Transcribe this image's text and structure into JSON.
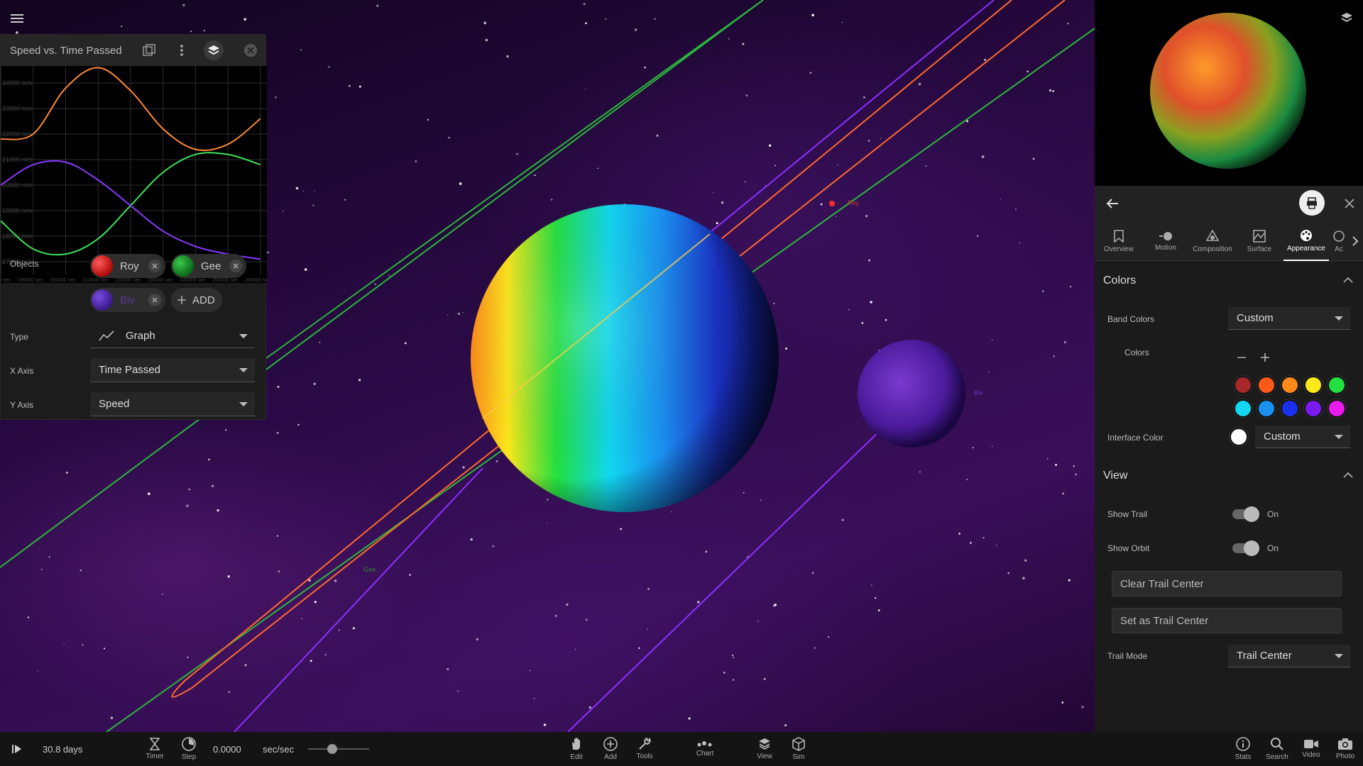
{
  "viewport": {
    "labels": {
      "roy": "Roy",
      "gee": "Gee",
      "biv": "Biv"
    }
  },
  "chart_window": {
    "title": "Speed vs. Time Passed",
    "objects_label": "Objects",
    "objects": [
      {
        "name": "Roy",
        "color": "#d21a1a"
      },
      {
        "name": "Gee",
        "color": "#1a8a2a"
      },
      {
        "name": "Biv",
        "color": "#5a2ab8"
      }
    ],
    "add_label": "ADD",
    "type_label": "Type",
    "type_value": "Graph",
    "x_axis_label": "X Axis",
    "x_axis_value": "Time Passed",
    "y_axis_label": "Y Axis",
    "y_axis_value": "Speed"
  },
  "chart_data": {
    "type": "line",
    "ylabel_ticks": [
      "24000 m/s",
      "23000 m/s",
      "22000 m/s",
      "21000 m/s",
      "20000 m/s",
      "19000 m/s",
      "18000 m/s",
      "17000 m/s"
    ],
    "x_ticks": [
      "180000 sec",
      "190000 sec",
      "200000 sec",
      "210000 sec",
      "220000 sec",
      "230000 sec",
      "240000 sec",
      "250000 sec",
      "260000 sec"
    ],
    "ylim": [
      16500,
      24500
    ],
    "xlim": [
      180000,
      262000
    ],
    "grid": true,
    "series": [
      {
        "name": "Roy",
        "color": "#ff8a3a",
        "x": [
          180000,
          190000,
          200000,
          210000,
          220000,
          230000,
          240000,
          250000,
          260000
        ],
        "y": [
          21800,
          22000,
          23800,
          24600,
          23700,
          22200,
          21400,
          21600,
          22600
        ]
      },
      {
        "name": "Gee",
        "color": "#3ae35a",
        "x": [
          180000,
          190000,
          200000,
          210000,
          220000,
          230000,
          240000,
          250000,
          260000
        ],
        "y": [
          18600,
          17500,
          17300,
          17900,
          19200,
          20500,
          21200,
          21200,
          20800
        ]
      },
      {
        "name": "Biv",
        "color": "#8a3aff",
        "x": [
          180000,
          190000,
          200000,
          210000,
          220000,
          230000,
          240000,
          250000,
          260000
        ],
        "y": [
          20000,
          20800,
          20900,
          20200,
          19200,
          18200,
          17600,
          17300,
          17100
        ]
      }
    ]
  },
  "panel": {
    "tabs": [
      "Overview",
      "Motion",
      "Composition",
      "Surface",
      "Appearance",
      "Ac"
    ],
    "active_tab": "Appearance",
    "colors_section": "Colors",
    "band_colors_label": "Band Colors",
    "band_colors_value": "Custom",
    "colors_label": "Colors",
    "swatches": [
      "#a8282a",
      "#ff5a1a",
      "#ff8a1a",
      "#ffe81a",
      "#22e040",
      "#11d8f0",
      "#1a90f0",
      "#1a30f0",
      "#7a1af0",
      "#e81af0"
    ],
    "interface_color_label": "Interface Color",
    "interface_color_value": "Custom",
    "view_section": "View",
    "show_trail_label": "Show Trail",
    "show_trail_value": "On",
    "show_orbit_label": "Show Orbit",
    "show_orbit_value": "On",
    "clear_trail_center": "Clear Trail Center",
    "set_trail_center": "Set as Trail Center",
    "trail_mode_label": "Trail Mode",
    "trail_mode_value": "Trail Center"
  },
  "toolbar": {
    "time_passed": "30.8 days",
    "timer_label": "Timer",
    "step_label": "Step",
    "rate_value": "0.0000",
    "rate_unit": "sec/sec",
    "edit_label": "Edit",
    "add_label": "Add",
    "tools_label": "Tools",
    "chart_label": "Chart",
    "view_label": "View",
    "sim_label": "Sim",
    "stats_label": "Stats",
    "search_label": "Search",
    "video_label": "Video",
    "photo_label": "Photo",
    "speed_slider_fraction": 0.4
  }
}
